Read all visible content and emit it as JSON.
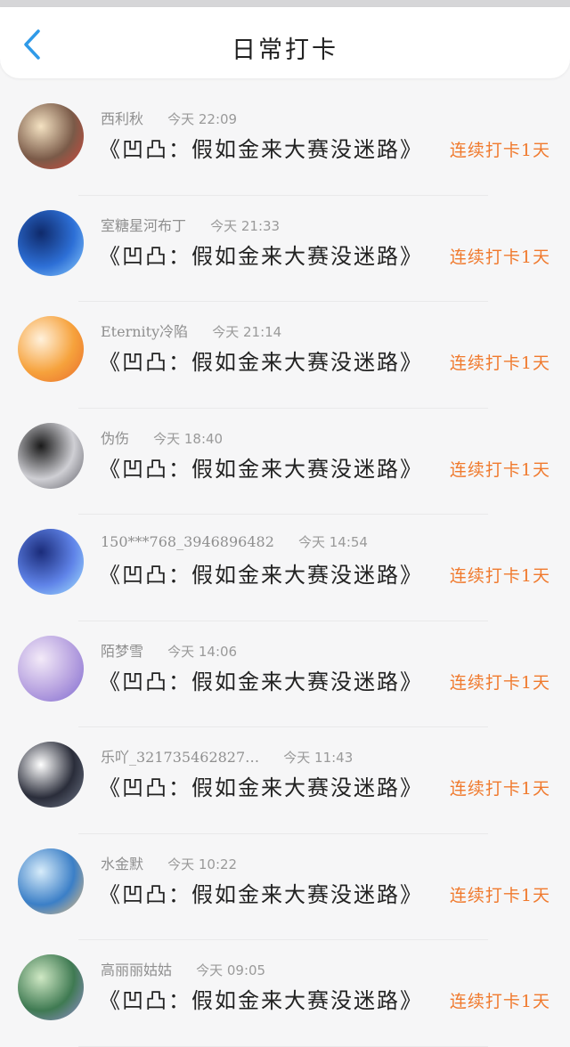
{
  "header": {
    "title": "日常打卡",
    "back_icon": "chevron-left-icon",
    "accent_color": "#2f9ae8"
  },
  "streak_color": "#f07a2e",
  "entries": [
    {
      "name": "西利秋",
      "time": "今天 22:09",
      "book": "《凹凸：假如金来大赛没迷路》",
      "streak": "连续打卡1天",
      "avatar_colors": [
        "#f4e2c2",
        "#7a5a48",
        "#d9473c"
      ]
    },
    {
      "name": "室糖星河布丁",
      "time": "今天 21:33",
      "book": "《凹凸：假如金来大赛没迷路》",
      "streak": "连续打卡1天",
      "avatar_colors": [
        "#0f2a6b",
        "#2d6fd6",
        "#8fd0ff"
      ]
    },
    {
      "name": "Eternity冷陷",
      "time": "今天 21:14",
      "book": "《凹凸：假如金来大赛没迷路》",
      "streak": "连续打卡1天",
      "avatar_colors": [
        "#fff1dc",
        "#f6a23c",
        "#e86a2c"
      ]
    },
    {
      "name": "伪伤",
      "time": "今天 18:40",
      "book": "《凹凸：假如金来大赛没迷路》",
      "streak": "连续打卡1天",
      "avatar_colors": [
        "#1a1a1a",
        "#cfcfd4",
        "#5a5a62"
      ]
    },
    {
      "name": "150***768_3946896482",
      "time": "今天 14:54",
      "book": "《凹凸：假如金来大赛没迷路》",
      "streak": "连续打卡1天",
      "avatar_colors": [
        "#1b2c7a",
        "#5f83e8",
        "#a8e6ff"
      ]
    },
    {
      "name": "陌梦雪",
      "time": "今天 14:06",
      "book": "《凹凸：假如金来大赛没迷路》",
      "streak": "连续打卡1天",
      "avatar_colors": [
        "#f3eaf8",
        "#b7a2e0",
        "#7f6ad0"
      ]
    },
    {
      "name": "乐吖_321735462827…",
      "time": "今天 11:43",
      "book": "《凹凸：假如金来大赛没迷路》",
      "streak": "连续打卡1天",
      "avatar_colors": [
        "#ffffff",
        "#2a2d3a",
        "#737b8c"
      ]
    },
    {
      "name": "水金默",
      "time": "今天 10:22",
      "book": "《凹凸：假如金来大赛没迷路》",
      "streak": "连续打卡1天",
      "avatar_colors": [
        "#d7ecfa",
        "#3b7fc7",
        "#f2c27a"
      ]
    },
    {
      "name": "高丽丽姑姑",
      "time": "今天 09:05",
      "book": "《凹凸：假如金来大赛没迷路》",
      "streak": "连续打卡1天",
      "avatar_colors": [
        "#cfe8c4",
        "#3f7a52",
        "#9a8fd8"
      ]
    }
  ]
}
